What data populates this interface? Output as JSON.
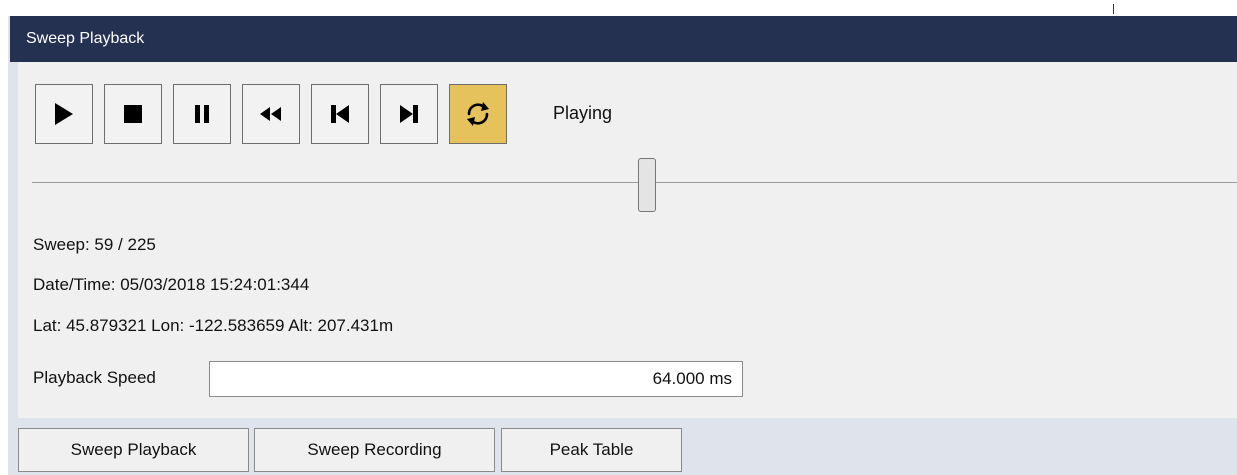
{
  "panel": {
    "title": "Sweep Playback"
  },
  "controls": {
    "play": "play-icon",
    "stop": "stop-icon",
    "pause": "pause-icon",
    "rewind": "rewind-icon",
    "skip_back": "skip-back-icon",
    "skip_forward": "skip-forward-icon",
    "loop": "loop-icon",
    "loop_active": true,
    "active_color": "#e6c25c"
  },
  "status": "Playing",
  "slider": {
    "position": 0.51
  },
  "info": {
    "sweep": "Sweep: 59 / 225",
    "datetime": "Date/Time: 05/03/2018 15:24:01:344",
    "location": "Lat: 45.879321  Lon: -122.583659  Alt: 207.431m"
  },
  "speed": {
    "label": "Playback Speed",
    "value": "64.000 ms"
  },
  "tabs": [
    {
      "label": "Sweep Playback"
    },
    {
      "label": "Sweep Recording"
    },
    {
      "label": "Peak Table"
    }
  ],
  "colors": {
    "titlebar": "#253150",
    "panel": "#f0f0f0",
    "frame": "#dfe3ec"
  }
}
